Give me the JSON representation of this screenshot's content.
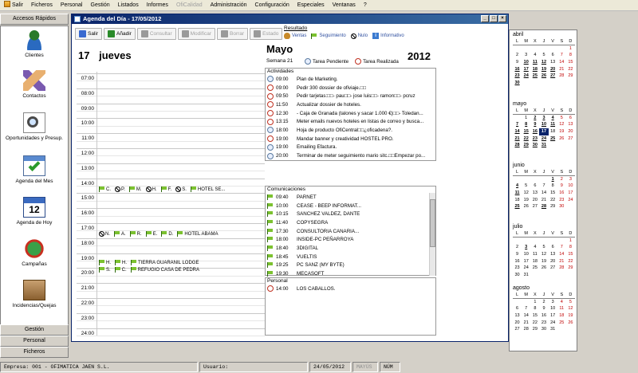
{
  "menubar": {
    "items": [
      {
        "label": "Salir",
        "enabled": true
      },
      {
        "label": "Ficheros",
        "enabled": true
      },
      {
        "label": "Personal",
        "enabled": true
      },
      {
        "label": "Gestión",
        "enabled": true
      },
      {
        "label": "Listados",
        "enabled": true
      },
      {
        "label": "Informes",
        "enabled": true
      },
      {
        "label": "OfiCalidad",
        "enabled": false
      },
      {
        "label": "Administración",
        "enabled": true
      },
      {
        "label": "Configuración",
        "enabled": true
      },
      {
        "label": "Especiales",
        "enabled": true
      },
      {
        "label": "Ventanas",
        "enabled": true
      },
      {
        "label": "?",
        "enabled": true
      }
    ]
  },
  "sidebar": {
    "header": "Accesos Rápidos",
    "items": [
      {
        "label": "Clientes",
        "icon": "users-icon"
      },
      {
        "label": "Contactos",
        "icon": "handshake-icon"
      },
      {
        "label": "Oportunidades y Presup.",
        "icon": "magnifier-document-icon"
      },
      {
        "label": "Agenda del Mes",
        "icon": "calendar-check-icon"
      },
      {
        "label": "Agenda de Hoy",
        "icon": "calendar-day-icon"
      },
      {
        "label": "Campañas",
        "icon": "globe-icon"
      },
      {
        "label": "Incidencias/Quejas",
        "icon": "box-icon"
      }
    ],
    "calendar_day_number": "12",
    "bottom_buttons": [
      "Gestión",
      "Personal",
      "Ficheros"
    ]
  },
  "window": {
    "title": "Agenda del Día - 17/05/2012",
    "toolbar": [
      {
        "label": "Salir",
        "enabled": true,
        "icon": "exit-icon"
      },
      {
        "label": "Añadir",
        "enabled": true,
        "icon": "add-icon"
      },
      {
        "label": "Consultar",
        "enabled": false,
        "icon": "consult-icon"
      },
      {
        "label": "Modificar",
        "enabled": false,
        "icon": "edit-icon"
      },
      {
        "label": "Borrar",
        "enabled": false,
        "icon": "delete-icon"
      },
      {
        "label": "Estado",
        "enabled": false,
        "icon": "status-icon"
      }
    ],
    "legend": {
      "title": "Resultado",
      "items": [
        "Ventas",
        "Seguimiento",
        "Nulo",
        "Informativo"
      ]
    },
    "day_header": {
      "day": "17",
      "weekday": "jueves"
    },
    "hours": [
      "07:00",
      "08:00",
      "09:00",
      "10:00",
      "11:00",
      "12:00",
      "13:00",
      "14:00",
      "15:00",
      "16:00",
      "17:00",
      "18:00",
      "19:00",
      "20:00",
      "21:00",
      "22:00",
      "23:00",
      "24:00"
    ],
    "day_appointments": [
      {
        "row": "14:00",
        "items": [
          {
            "i": "flag",
            "t": "C."
          },
          {
            "i": "no",
            "t": "P."
          },
          {
            "i": "flag",
            "t": "M."
          },
          {
            "i": "no",
            "t": "H."
          },
          {
            "i": "flag",
            "t": "F."
          },
          {
            "i": "no",
            "t": "S."
          },
          {
            "i": "flag",
            "t": "HOTEL SE..."
          }
        ]
      },
      {
        "row": "17:00",
        "items": [
          {
            "i": "no",
            "t": "N."
          },
          {
            "i": "flag",
            "t": "A."
          },
          {
            "i": "flag",
            "t": "R."
          },
          {
            "i": "flag",
            "t": "E."
          },
          {
            "i": "flag",
            "t": "D."
          },
          {
            "i": "flag",
            "t": "HOTEL ABAMA"
          }
        ]
      },
      {
        "row": "19:00a",
        "items": [
          {
            "i": "flag",
            "t": "H."
          },
          {
            "i": "flag",
            "t": "H."
          },
          {
            "i": "flag",
            "t": "TIERRA GUARANIL LODGE"
          }
        ]
      },
      {
        "row": "19:00b",
        "items": [
          {
            "i": "flag",
            "t": "S."
          },
          {
            "i": "flag",
            "t": "C."
          },
          {
            "i": "flag",
            "t": "REFUGIO CASA DE PEDRA"
          }
        ]
      }
    ],
    "summary": {
      "month": "Mayo",
      "year": "2012",
      "week": "Semana 21",
      "status_legend": [
        "Tarea Pendiente",
        "Tarea Realizada"
      ]
    },
    "actividades": {
      "title": "Actividades",
      "rows": [
        {
          "time": "09:00",
          "status": "pending",
          "text": "Plan de Marketing."
        },
        {
          "time": "09:00",
          "status": "done",
          "text": "Pedir 300 dossier de ofiviaje.□□"
        },
        {
          "time": "09:50",
          "status": "done",
          "text": "Pedir tarjetas:□□- pau□□- jose luis□□- ramon□□- pcruz"
        },
        {
          "time": "11:50",
          "status": "done",
          "text": "Actualizar dossier de hoteles."
        },
        {
          "time": "12:30",
          "status": "done",
          "text": "- Caja de Granada (talones y sacar 1.000 €)□□- Toledan..."
        },
        {
          "time": "13:15",
          "status": "done",
          "text": "Meter emails nuevos hoteles en listas de correo y busca..."
        },
        {
          "time": "18:00",
          "status": "pending",
          "text": "Hoja de producto OfiCentral□□¿oficadena?."
        },
        {
          "time": "19:00",
          "status": "done",
          "text": "Mandar banner y creatividad HOSTEL PRO."
        },
        {
          "time": "19:00",
          "status": "pending",
          "text": "Emailing Efactura."
        },
        {
          "time": "20:00",
          "status": "pending",
          "text": "Terminar de meter seguimiento mario sitc.□□Empezar po..."
        }
      ]
    },
    "comunicaciones": {
      "title": "Comunicaciones",
      "rows": [
        {
          "time": "09:40",
          "text": "PARNET"
        },
        {
          "time": "10:00",
          "text": "CEASE - BEEP INFORMAT..."
        },
        {
          "time": "10:15",
          "text": "SANCHEZ VALDEZ, DANTE"
        },
        {
          "time": "11:40",
          "text": "COPYSEGRA"
        },
        {
          "time": "17:30",
          "text": "CONSULTORIA CANARIA..."
        },
        {
          "time": "18:00",
          "text": "INSIDE-PC PEÑARROYA"
        },
        {
          "time": "18:40",
          "text": "3DIGITAL"
        },
        {
          "time": "18:45",
          "text": "VUELTIS"
        },
        {
          "time": "19:25",
          "text": "PC SANZ (MY BYTE)"
        },
        {
          "time": "19:30",
          "text": "MECASOFT"
        }
      ]
    },
    "personal": {
      "title": "Personal",
      "rows": [
        {
          "time": "14:00",
          "status": "done",
          "text": "LOS CABALLOS."
        }
      ]
    }
  },
  "calendars": {
    "dows": [
      "L",
      "M",
      "X",
      "J",
      "V",
      "S",
      "D"
    ],
    "months": [
      {
        "name": "abril",
        "weeks": [
          [
            "",
            "",
            "",
            "",
            "",
            "",
            "1"
          ],
          [
            "2",
            "3",
            "4",
            "5",
            "6",
            "7",
            "8"
          ],
          [
            "9",
            "10",
            "11",
            "12",
            "13",
            "14",
            "15"
          ],
          [
            "16",
            "17",
            "18",
            "19",
            "20",
            "21",
            "22"
          ],
          [
            "23",
            "24",
            "25",
            "26",
            "27",
            "28",
            "29"
          ],
          [
            "30",
            "",
            "",
            "",
            "",
            "",
            ""
          ]
        ],
        "bold": [
          "10",
          "11",
          "12",
          "16",
          "17",
          "18",
          "19",
          "20",
          "23",
          "24",
          "25",
          "26",
          "27",
          "30"
        ]
      },
      {
        "name": "mayo",
        "weeks": [
          [
            "",
            "1",
            "2",
            "3",
            "4",
            "5",
            "6"
          ],
          [
            "7",
            "8",
            "9",
            "10",
            "11",
            "12",
            "13"
          ],
          [
            "14",
            "15",
            "16",
            "17",
            "18",
            "19",
            "20"
          ],
          [
            "21",
            "22",
            "23",
            "24",
            "25",
            "26",
            "27"
          ],
          [
            "28",
            "29",
            "30",
            "31",
            "",
            "",
            ""
          ]
        ],
        "bold": [
          "2",
          "3",
          "4",
          "7",
          "8",
          "9",
          "10",
          "11",
          "14",
          "15",
          "16",
          "21",
          "22",
          "23",
          "24",
          "25",
          "28",
          "29",
          "30",
          "31"
        ],
        "selected": "17"
      },
      {
        "name": "junio",
        "weeks": [
          [
            "",
            "",
            "",
            "",
            "1",
            "2",
            "3"
          ],
          [
            "4",
            "5",
            "6",
            "7",
            "8",
            "9",
            "10"
          ],
          [
            "11",
            "12",
            "13",
            "14",
            "15",
            "16",
            "17"
          ],
          [
            "18",
            "19",
            "20",
            "21",
            "22",
            "23",
            "24"
          ],
          [
            "25",
            "26",
            "27",
            "28",
            "29",
            "30",
            ""
          ]
        ],
        "bold": [
          "1",
          "4",
          "11",
          "25",
          "28"
        ]
      },
      {
        "name": "julio",
        "weeks": [
          [
            "",
            "",
            "",
            "",
            "",
            "",
            "1"
          ],
          [
            "2",
            "3",
            "4",
            "5",
            "6",
            "7",
            "8"
          ],
          [
            "9",
            "10",
            "11",
            "12",
            "13",
            "14",
            "15"
          ],
          [
            "16",
            "17",
            "18",
            "19",
            "20",
            "21",
            "22"
          ],
          [
            "23",
            "24",
            "25",
            "26",
            "27",
            "28",
            "29"
          ],
          [
            "30",
            "31",
            "",
            "",
            "",
            "",
            ""
          ]
        ],
        "bold": [
          "3"
        ]
      },
      {
        "name": "agosto",
        "weeks": [
          [
            "",
            "",
            "1",
            "2",
            "3",
            "4",
            "5"
          ],
          [
            "6",
            "7",
            "8",
            "9",
            "10",
            "11",
            "12"
          ],
          [
            "13",
            "14",
            "15",
            "16",
            "17",
            "18",
            "19"
          ],
          [
            "20",
            "21",
            "22",
            "23",
            "24",
            "25",
            "26"
          ],
          [
            "27",
            "28",
            "29",
            "30",
            "31",
            "",
            ""
          ]
        ],
        "bold": []
      }
    ]
  },
  "statusbar": {
    "empresa": "Empresa: 001 - OFIMATICA JAEN S.L.",
    "usuario": "Usuario:",
    "fecha": "24/05/2012",
    "mayus": "MAYÚS",
    "num": "NÚM"
  }
}
